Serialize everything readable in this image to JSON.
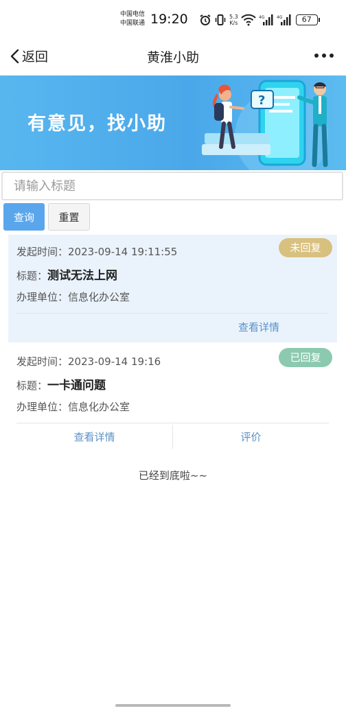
{
  "status_bar": {
    "carrier_1": "中国电信",
    "carrier_2": "中国联通",
    "time": "19:20",
    "net_speed_value": "5.3",
    "net_speed_unit": "K/s",
    "battery": "67"
  },
  "navbar": {
    "back_label": "返回",
    "title": "黄淮小助"
  },
  "banner": {
    "text": "有意见，找小助"
  },
  "search": {
    "placeholder": "请输入标题",
    "value": ""
  },
  "buttons": {
    "query": "查询",
    "reset": "重置"
  },
  "labels": {
    "time": "发起时间：",
    "title": "标题：",
    "unit": "办理单位："
  },
  "items": [
    {
      "time": "2023-09-14 19:11:55",
      "title": "测试无法上网",
      "unit": "信息化办公室",
      "status": "未回复",
      "actions": [
        "查看详情"
      ]
    },
    {
      "time": "2023-09-14 19:16",
      "title": "一卡通问题",
      "unit": "信息化办公室",
      "status": "已回复",
      "actions": [
        "查看详情",
        "评价"
      ]
    }
  ],
  "end_text": "已经到底啦~~",
  "colors": {
    "primary": "#5aa6ec",
    "pending_badge": "#d8c07f",
    "done_badge": "#8ccab0",
    "link": "#5b91c7",
    "highlight_card": "#eaf3fc"
  }
}
